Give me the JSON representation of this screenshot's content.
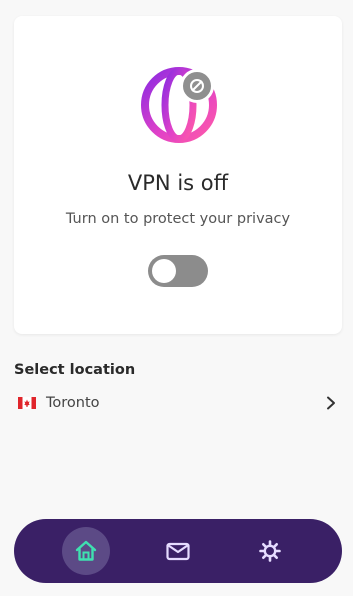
{
  "status": {
    "title": "VPN is off",
    "subtitle": "Turn on to protect your privacy",
    "toggle_on": false
  },
  "location": {
    "section_title": "Select location",
    "country_flag": "canada-flag-icon",
    "city": "Toronto"
  },
  "nav": {
    "items": [
      {
        "name": "home",
        "icon": "home-icon",
        "active": true
      },
      {
        "name": "messages",
        "icon": "mail-icon",
        "active": false
      },
      {
        "name": "settings",
        "icon": "gear-icon",
        "active": false
      }
    ]
  },
  "colors": {
    "nav_background": "#3a2066",
    "nav_active": "#5c4a86",
    "accent_teal": "#3fe1b0",
    "globe_gradient_start": "#9b2fd8",
    "globe_gradient_end": "#ff4fa3",
    "badge_gray": "#8f8f8f"
  }
}
